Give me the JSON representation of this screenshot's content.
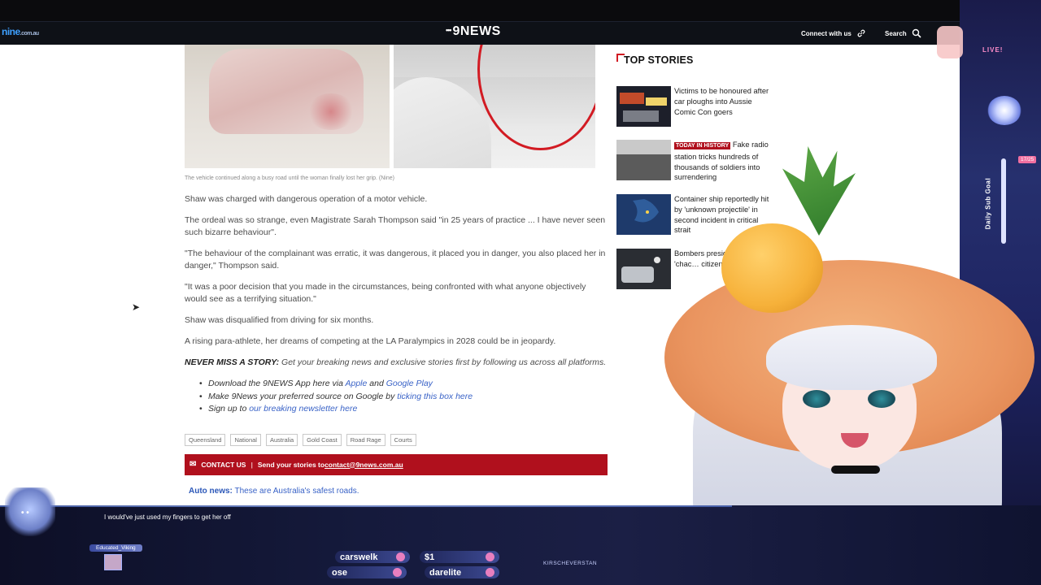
{
  "nav": {
    "logo": "nine",
    "logo_domain": ".com.au",
    "brand_dots": "•••",
    "brand": "9NEWS",
    "connect": "Connect with us",
    "search": "Search"
  },
  "article": {
    "caption": "The vehicle continued along a busy road until the woman finally lost her grip. (Nine)",
    "paragraphs": [
      "Shaw was charged with dangerous operation of a motor vehicle.",
      "The ordeal was so strange, even Magistrate Sarah Thompson said \"in 25 years of practice ... I have never seen such bizarre behaviour\".",
      "\"The behaviour of the complainant was erratic, it was dangerous, it placed you in danger, you also placed her in danger,\" Thompson said.",
      "\"It was a poor decision that you made in the circumstances, being confronted with what anyone objectively would see as a terrifying situation.\"",
      "Shaw was disqualified from driving for six months.",
      "A rising para-athlete, her dreams of competing at the LA Paralympics in 2028 could be in jeopardy."
    ],
    "cta_bold": "NEVER MISS A STORY:",
    "cta_text": " Get your breaking news and exclusive stories first by following us across all platforms.",
    "bullets": [
      {
        "pre": "Download the 9NEWS App here via ",
        "link1": "Apple",
        "mid": " and ",
        "link2": "Google Play"
      },
      {
        "pre": "Make 9News your preferred source on Google by ",
        "link1": "ticking this box here"
      },
      {
        "pre": "Sign up to ",
        "link1": "our breaking newsletter here"
      }
    ],
    "tags": [
      "Queensland",
      "National",
      "Australia",
      "Gold Coast",
      "Road Rage",
      "Courts"
    ],
    "contact_label": "CONTACT US",
    "contact_text": "Send your stories to ",
    "contact_email": "contact@9news.com.au",
    "auto_bold": "Auto news:",
    "auto_text": " These are Australia's safest roads."
  },
  "sidebar": {
    "title": "TOP STORIES",
    "stories": [
      {
        "badge": "",
        "text": "Victims to be honoured after car ploughs into Aussie Comic Con goers"
      },
      {
        "badge": "TODAY IN HISTORY",
        "text": " Fake radio station tricks hundreds of thousands of soldiers into surrendering"
      },
      {
        "badge": "",
        "text": "Container ship reportedly hit by 'unknown projectile' in second incident in critical strait"
      },
      {
        "badge": "",
        "text": "Bombers preside… performs 'chac… citizen's arres…"
      }
    ]
  },
  "stream": {
    "chat_message": "I would've just used my fingers to get her off",
    "chat_user": "Educated_Viking",
    "pills": [
      "carswelk",
      "$1",
      "ose",
      "darelite"
    ],
    "ticker": "KIRSCHEVERSTAN",
    "live": "LIVE!",
    "goal_label": "Daily Sub Goal",
    "goal_count": "17/25"
  },
  "colors": {
    "accent_red": "#b0101d",
    "link_blue": "#3a63c7",
    "nav_bg": "#0b0b0d"
  }
}
